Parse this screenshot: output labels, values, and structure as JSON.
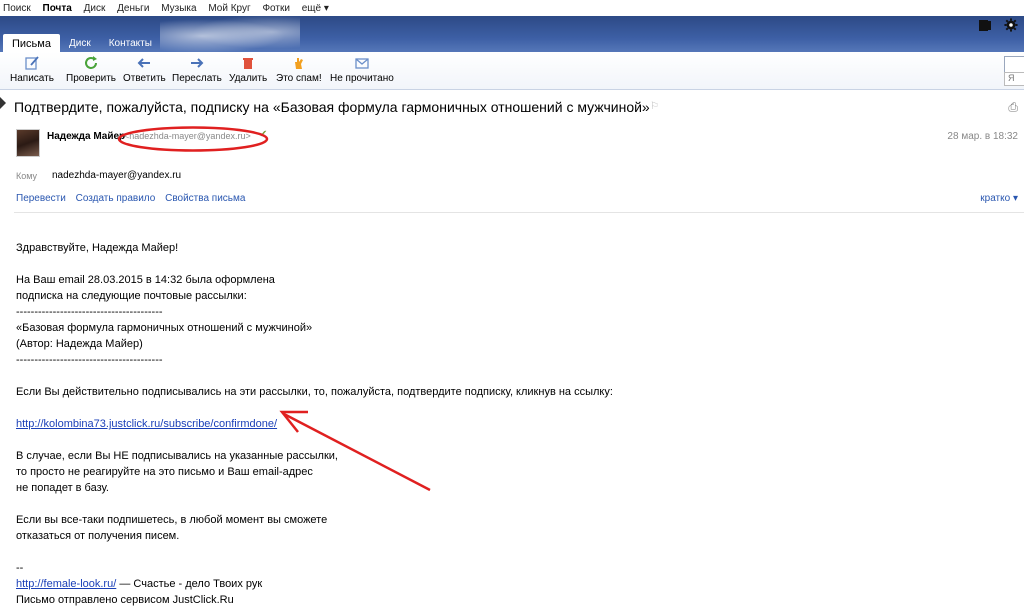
{
  "services": [
    "Поиск",
    "Почта",
    "Диск",
    "Деньги",
    "Музыка",
    "Мой Круг",
    "Фотки",
    "ещё ▾"
  ],
  "services_active_index": 1,
  "tabs": [
    "Письма",
    "Диск",
    "Контакты"
  ],
  "toolbar": {
    "compose": "Написать",
    "check": "Проверить",
    "reply": "Ответить",
    "forward": "Переслать",
    "delete": "Удалить",
    "spam": "Это спам!",
    "unread": "Не прочитано"
  },
  "message": {
    "subject": "Подтвердите, пожалуйста, подписку на «Базовая формула гармоничных отношений с мужчиной»",
    "sender_name": "Надежда Майер",
    "sender_email": "<nadezhda-mayer@yandex.ru>",
    "date": "28 мар. в 18:32",
    "to_label": "Кому",
    "to_value": "nadezhda-mayer@yandex.ru",
    "actions": [
      "Перевести",
      "Создать правило",
      "Свойства письма"
    ],
    "brief": "кратко ▾"
  },
  "body": {
    "greeting": "Здравствуйте, Надежда Майер!",
    "line1": "На Ваш email 28.03.2015 в 14:32 была оформлена",
    "line2": "подписка на следующие почтовые рассылки:",
    "sep": "----------------------------------------",
    "list_item": "«Базовая формула гармоничных отношений с мужчиной»",
    "author": "(Автор: Надежда Майер)",
    "confirm": "Если Вы действительно подписывались на эти рассылки, то, пожалуйста, подтвердите подписку, кликнув на ссылку:",
    "link": "http://kolombina73.justclick.ru/subscribe/confirmdone/",
    "no1": "В случае, если Вы НЕ подписывались на указанные рассылки,",
    "no2": "то просто не реагируйте на это письмо и Ваш email-адрес",
    "no3": "не попадет в базу.",
    "later1": "Если вы все-таки подпишетесь, в любой момент вы сможете",
    "later2": "отказаться от получения писем.",
    "dashes": "--",
    "sig_link": "http://female-look.ru/",
    "sig_text": " — Счастье - дело Твоих рук",
    "sent_by": "Письмо отправлено сервисом JustClick.Ru"
  },
  "colors": {
    "link": "#1a3fb8",
    "annotation_red": "#e02020",
    "header_blue": "#3d5fa5"
  }
}
